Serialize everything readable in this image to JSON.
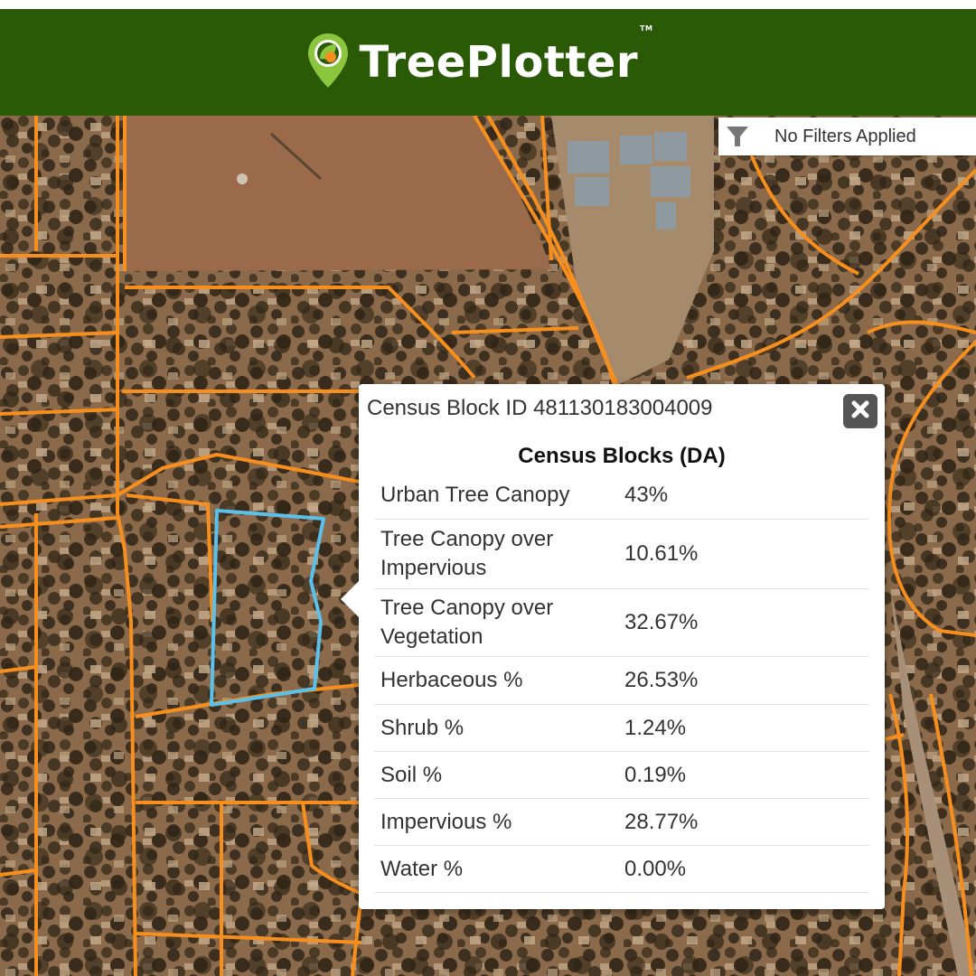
{
  "app": {
    "name": "TreePlotter",
    "trademark": "TM",
    "brand_color": "#2a5a06",
    "logo_icon": "map-pin-leaf-icon"
  },
  "filters": {
    "icon": "filter-icon",
    "label": "No Filters Applied"
  },
  "map": {
    "boundary_color": "#f78f1e",
    "selected_color": "#5bc0ea"
  },
  "popup": {
    "title": "Census Block ID 481130183004009",
    "close_icon": "close-icon",
    "section_title": "Census Blocks (DA)",
    "rows": [
      {
        "label": "Urban Tree Canopy",
        "value": "43%"
      },
      {
        "label": "Tree Canopy over Impervious",
        "value": "10.61%"
      },
      {
        "label": "Tree Canopy over Vegetation",
        "value": "32.67%"
      },
      {
        "label": "Herbaceous %",
        "value": "26.53%"
      },
      {
        "label": "Shrub %",
        "value": "1.24%"
      },
      {
        "label": "Soil %",
        "value": "0.19%"
      },
      {
        "label": "Impervious %",
        "value": "28.77%"
      },
      {
        "label": "Water %",
        "value": "0.00%"
      }
    ]
  }
}
